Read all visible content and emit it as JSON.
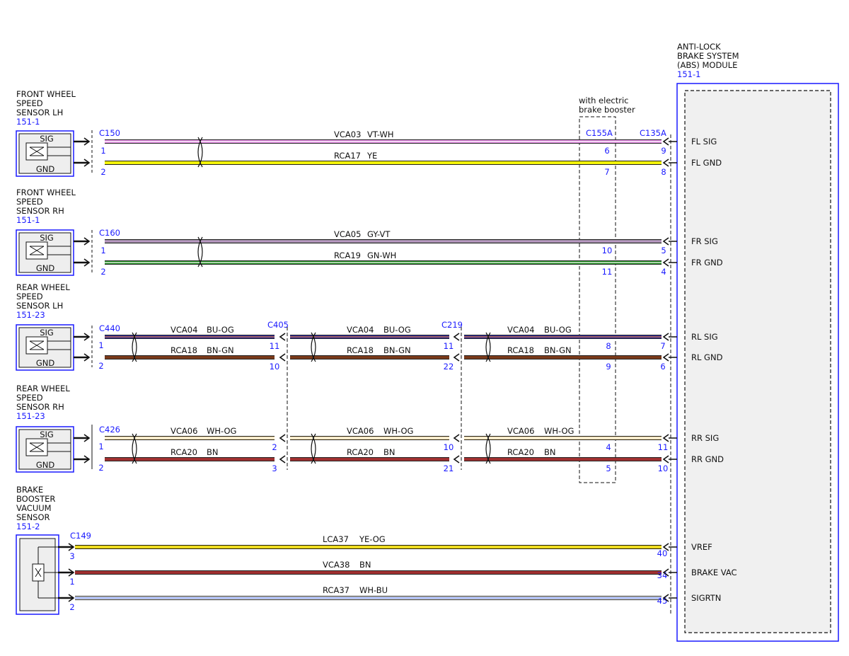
{
  "abs_module": {
    "title": [
      "ANTI-LOCK",
      "BRAKE SYSTEM",
      "(ABS) MODULE"
    ],
    "ref": "151-1",
    "pins": [
      "FL SIG",
      "FL GND",
      "FR SIG",
      "FR GND",
      "RL SIG",
      "RL GND",
      "RR SIG",
      "RR GND",
      "VREF",
      "BRAKE VAC",
      "SIGRTN"
    ]
  },
  "booster_note": [
    "with electric",
    "brake booster"
  ],
  "sensors": [
    {
      "title": [
        "FRONT WHEEL",
        "SPEED",
        "SENSOR LH"
      ],
      "ref": "151-1",
      "pin_labels": [
        "SIG",
        "GND"
      ],
      "connectors": [
        "C150",
        "C155A",
        "C135A"
      ],
      "wires": [
        {
          "circuit": "VCA03",
          "color_code": "VT-WH",
          "segments": [
            {
              "a": "1",
              "b": "6",
              "color": "#e48ae4",
              "stripe": "#ffffff"
            },
            {
              "a": "",
              "b": "9",
              "color": "#e48ae4",
              "stripe": "#ffffff"
            }
          ]
        },
        {
          "circuit": "RCA17",
          "color_code": "YE",
          "segments": [
            {
              "a": "2",
              "b": "7",
              "color": "#f2f20a",
              "stripe": ""
            },
            {
              "a": "",
              "b": "8",
              "color": "#f2f20a",
              "stripe": ""
            }
          ]
        }
      ]
    },
    {
      "title": [
        "FRONT WHEEL",
        "SPEED",
        "SENSOR RH"
      ],
      "ref": "151-1",
      "pin_labels": [
        "SIG",
        "GND"
      ],
      "connectors": [
        "C160"
      ],
      "wires": [
        {
          "circuit": "VCA05",
          "color_code": "GY-VT",
          "segments": [
            {
              "a": "1",
              "b": "10",
              "color": "#9a8aa0",
              "stripe": "#c9a0d6"
            },
            {
              "a": "",
              "b": "5",
              "color": "#9a8aa0",
              "stripe": "#c9a0d6"
            }
          ]
        },
        {
          "circuit": "RCA19",
          "color_code": "GN-WH",
          "segments": [
            {
              "a": "2",
              "b": "11",
              "color": "#1f8f1f",
              "stripe": "#ffffff"
            },
            {
              "a": "",
              "b": "4",
              "color": "#1f8f1f",
              "stripe": "#ffffff"
            }
          ]
        }
      ]
    },
    {
      "title": [
        "REAR WHEEL",
        "SPEED",
        "SENSOR LH"
      ],
      "ref": "151-23",
      "pin_labels": [
        "SIG",
        "GND"
      ],
      "connectors": [
        "C440",
        "C405",
        "C219"
      ],
      "wires": [
        {
          "circuit": "VCA04",
          "color_code": "BU-OG",
          "segments": [
            {
              "a": "1",
              "b": "11",
              "color": "#2a2aa8",
              "stripe": "#e07a2a"
            },
            {
              "a": "",
              "b": "11",
              "color": "#2a2aa8",
              "stripe": "#e07a2a"
            },
            {
              "a": "",
              "b": "8",
              "color": "#2a2aa8",
              "stripe": "#e07a2a"
            },
            {
              "a": "",
              "b": "7",
              "color": "#2a2aa8",
              "stripe": "#e07a2a"
            }
          ]
        },
        {
          "circuit": "RCA18",
          "color_code": "BN-GN",
          "segments": [
            {
              "a": "2",
              "b": "10",
              "color": "#7a3a1a",
              "stripe": ""
            },
            {
              "a": "",
              "b": "22",
              "color": "#7a3a1a",
              "stripe": ""
            },
            {
              "a": "",
              "b": "9",
              "color": "#7a3a1a",
              "stripe": ""
            },
            {
              "a": "",
              "b": "6",
              "color": "#7a3a1a",
              "stripe": ""
            }
          ]
        }
      ]
    },
    {
      "title": [
        "REAR WHEEL",
        "SPEED",
        "SENSOR RH"
      ],
      "ref": "151-23",
      "pin_labels": [
        "SIG",
        "GND"
      ],
      "connectors": [
        "C426"
      ],
      "wires": [
        {
          "circuit": "VCA06",
          "color_code": "WH-OG",
          "segments": [
            {
              "a": "1",
              "b": "2",
              "color": "#f0d8a0",
              "stripe": "#ffffff"
            },
            {
              "a": "",
              "b": "10",
              "color": "#f0d8a0",
              "stripe": "#ffffff"
            },
            {
              "a": "",
              "b": "4",
              "color": "#f0d8a0",
              "stripe": "#ffffff"
            },
            {
              "a": "",
              "b": "11",
              "color": "#f0d8a0",
              "stripe": "#ffffff"
            }
          ]
        },
        {
          "circuit": "RCA20",
          "color_code": "BN",
          "segments": [
            {
              "a": "2",
              "b": "3",
              "color": "#a03030",
              "stripe": ""
            },
            {
              "a": "",
              "b": "21",
              "color": "#a03030",
              "stripe": ""
            },
            {
              "a": "",
              "b": "5",
              "color": "#a03030",
              "stripe": ""
            },
            {
              "a": "",
              "b": "10",
              "color": "#a03030",
              "stripe": ""
            }
          ]
        }
      ]
    }
  ],
  "vacuum_sensor": {
    "title": [
      "BRAKE",
      "BOOSTER",
      "VACUUM",
      "SENSOR"
    ],
    "ref": "151-2",
    "connector": "C149",
    "wires": [
      {
        "circuit": "LCA37",
        "color_code": "YE-OG",
        "a": "3",
        "b": "40",
        "color": "#e8d000",
        "stripe": "#f5e84a"
      },
      {
        "circuit": "VCA38",
        "color_code": "BN",
        "a": "1",
        "b": "34",
        "color": "#a03030",
        "stripe": ""
      },
      {
        "circuit": "RCA37",
        "color_code": "WH-BU",
        "a": "2",
        "b": "45",
        "color": "#ffffff",
        "stripe": "#4a6ad6"
      }
    ]
  },
  "colors": {
    "accent": "#1a1aff",
    "line": "#111111"
  }
}
